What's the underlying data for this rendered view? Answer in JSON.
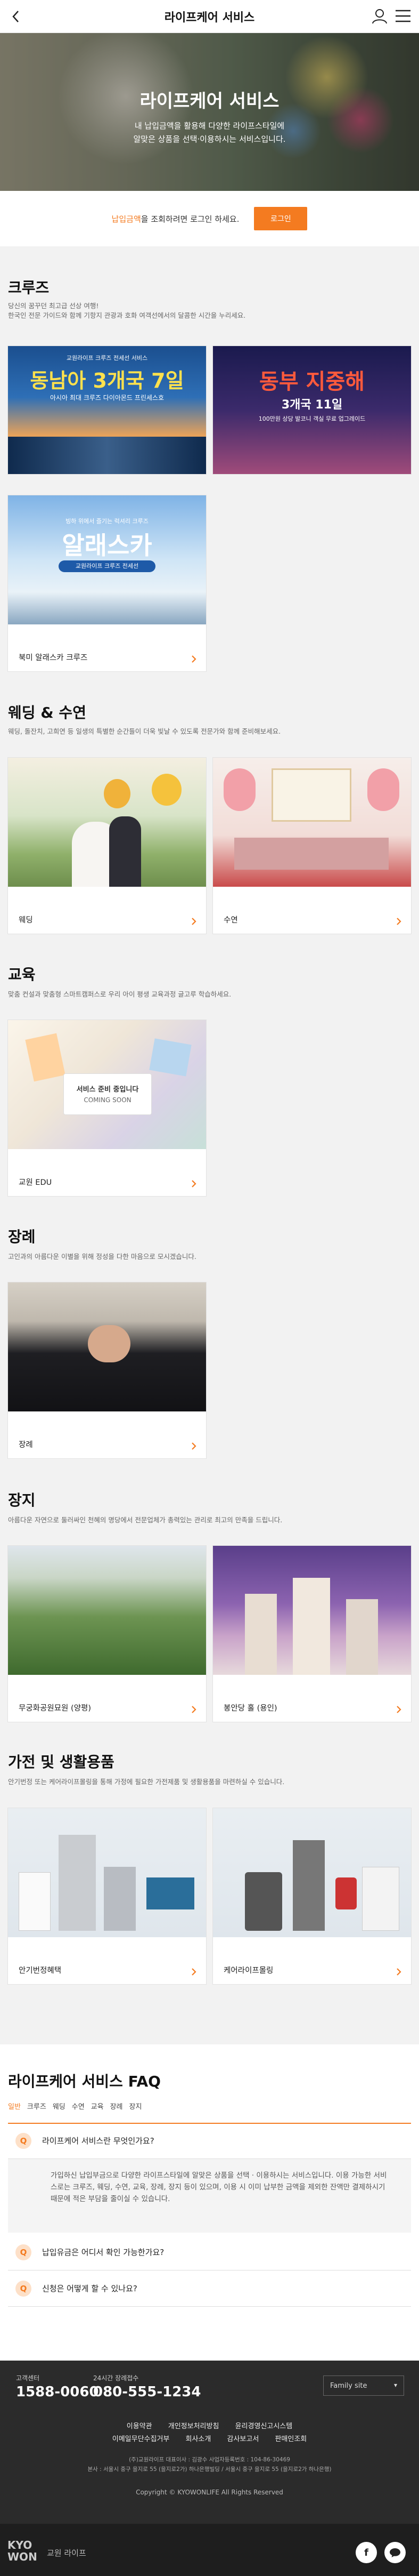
{
  "header": {
    "title": "라이프케어 서비스"
  },
  "hero": {
    "title": "라이프케어 서비스",
    "line1": "내 납입금액을 활용해 다양한 라이프스타일에",
    "line2": "알맞은 상품을 선택·이용하시는 서비스입니다."
  },
  "login_bar": {
    "highlight": "납입금액",
    "message": "을 조회하려면 로그인 하세요.",
    "button": "로그인"
  },
  "sections": {
    "cruise": {
      "title": "크루즈",
      "desc1": "당신의 꿈꾸던 최고급 선상 여행!",
      "desc2": "한국인 전문 가이드와 함께 기항지 관광과 호화 여객선에서의 달콤한 시간을 누리세요.",
      "cards": [
        {
          "label": "동남아 3개국 7일",
          "banner_title": "동남아 3개국 7일",
          "banner_top": "교원라이프 크루즈 전세선 서비스",
          "banner_sub": "아시아 최대 크루즈 다이아몬드 프린세스호"
        },
        {
          "label": "동부 지중해 3개국 11일",
          "banner_title": "동부 지중해",
          "banner_sub": "3개국 11일",
          "banner_note": "100만원 상당 발코니 객실 무료 업그레이드"
        },
        {
          "label": "북미 알래스카 크루즈",
          "banner_title": "알래스카",
          "banner_top": "빙하 위에서 즐기는 럭셔리 크루즈",
          "banner_sub": "교원라이프 크루즈 전세선"
        }
      ]
    },
    "wedding": {
      "title": "웨딩 & 수연",
      "desc": "웨딩, 돌잔치, 고희연 등 일생의 특별한 순간들이 더욱 빛날 수 있도록 전문가와 함께 준비해보세요.",
      "cards": [
        {
          "label": "웨딩"
        },
        {
          "label": "수연"
        }
      ]
    },
    "education": {
      "title": "교육",
      "desc": "맞춤 컨설과 맞춤형 스마트캠퍼스로 우리 아이 평생 교육과정 글고루 학습하세요.",
      "cards": [
        {
          "label": "교원 EDU",
          "panel1": "서비스 준비 중입니다",
          "panel2": "COMING SOON"
        }
      ]
    },
    "funeral": {
      "title": "장례",
      "desc": "고인과의 아름다운 이별을 위해 정성을 다한 마음으로 모시겠습니다.",
      "cards": [
        {
          "label": "장례"
        }
      ]
    },
    "burial": {
      "title": "장지",
      "desc": "아름다운 자연으로 둘러싸인 천혜의 명당에서 전문업체가 총력있는 관리로 최고의 만족을 드립니다.",
      "cards": [
        {
          "label": "무궁화공원묘원 (양평)"
        },
        {
          "label": "봉안당 홀 (용인)"
        }
      ]
    },
    "appliance": {
      "title": "가전 및 생활용품",
      "desc": "안기번정 또는 케어라이프몰링을 통해 가정에 필요한 가전제품 및 생활용품을 마련하실 수 있습니다.",
      "cards": [
        {
          "label": "안기번정혜택"
        },
        {
          "label": "케어라이프몰링"
        }
      ]
    }
  },
  "faq": {
    "title": "라이프케어 서비스 FAQ",
    "tabs": [
      "일반",
      "크루즈",
      "웨딩",
      "수연",
      "교육",
      "장례",
      "장지"
    ],
    "questions": [
      "라이프케어 서비스란 무엇인가요?",
      "납입유금은 어디서 확인 가능한가요?",
      "신청은 어떻게 할 수 있나요?"
    ],
    "badge": "Q",
    "answer": "가입하신 납입부금으로 다양한 라이프스타일에 알맞은 상품을 선택 · 이용하시는 서비스입니다. 이용 가능한 서비스로는 크루즈, 웨딩, 수연, 교육, 장례, 장지 등이 있으며, 이용 시 이미 납부한 금액을 제외한 잔액만 결제하시기 때문에 적은 부담을 줄이실 수 있습니다."
  },
  "footer": {
    "center_label": "고객센터",
    "center_number": "1588-0060",
    "night_label": "24시간 장례접수",
    "night_number": "080-555-1234",
    "family_site": "Family site",
    "links_row1": [
      "이용약관",
      "개인정보처리방침",
      "윤리경영신고시스템"
    ],
    "links_row2": [
      "이메일무단수집거부",
      "회사소개",
      "감사보고서",
      "판매인조회"
    ],
    "info1": "(주)교원라이프 대표이사 : 김광수 사업자등록번호 : 104-86-30469",
    "info2": "본사 : 서울시 중구 을지로 55 (을지로2가) 하나은행빌딩 / 서울시 중구 을지로 55 (을지로2가 하나은행)",
    "copyright": "Copyright © KYOWONLIFE All Rights Reserved",
    "logo_text": "KYO WON",
    "logo_sub": "교원 라이프"
  }
}
